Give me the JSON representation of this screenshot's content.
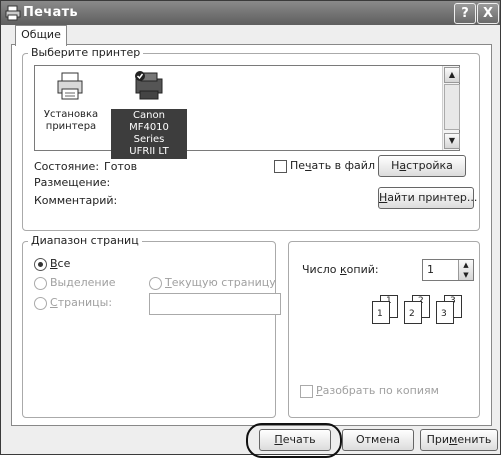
{
  "window": {
    "title": "Печать",
    "help_btn": "?",
    "close_btn": "X"
  },
  "tabs": [
    {
      "label": "Общие",
      "active": true
    }
  ],
  "printer_group": {
    "label": "Выберите принтер",
    "printers": [
      {
        "line1": "Установка",
        "line2": "принтера",
        "line3": "",
        "icon": "printer-add-icon",
        "selected": false
      },
      {
        "line1": "Canon",
        "line2": "MF4010 Series",
        "line3": "UFRII LT",
        "icon": "printer-default-icon",
        "selected": true
      }
    ]
  },
  "status": {
    "state_label": "Состояние:",
    "state_value": "Готов",
    "location_label": "Размещение:",
    "location_value": "",
    "comment_label": "Комментарий:",
    "comment_value": ""
  },
  "print_to_file": {
    "label_pre": "Пе",
    "label_u": "ч",
    "label_post": "ать в файл",
    "checked": false
  },
  "buttons": {
    "settings": {
      "pre": "Н",
      "u": "а",
      "post": "стройка"
    },
    "find_printer": {
      "pre": "",
      "u": "Н",
      "post": "айти принтер..."
    },
    "print": {
      "pre": "",
      "u": "П",
      "post": "ечать"
    },
    "cancel": "Отмена",
    "apply": {
      "pre": "При",
      "u": "м",
      "post": "енить"
    }
  },
  "page_range": {
    "label": "Диапазон страниц",
    "all": {
      "pre": "",
      "u": "В",
      "post": "се",
      "selected": true
    },
    "selection": {
      "pre": "Вы",
      "u": "д",
      "post": "еление",
      "enabled": false
    },
    "current_page": {
      "pre": "",
      "u": "Т",
      "post": "екущую страницу",
      "enabled": false
    },
    "pages": {
      "pre": "",
      "u": "С",
      "post": "траницы:",
      "enabled": false,
      "value": ""
    }
  },
  "copies": {
    "label_pre": "Число ",
    "label_u": "к",
    "label_post": "опий:",
    "value": "1",
    "collate": {
      "pre": "",
      "u": "Р",
      "post": "азобрать по копиям",
      "checked": false,
      "enabled": false
    },
    "pages_preview": [
      "1",
      "1",
      "2",
      "2",
      "3",
      "3"
    ]
  },
  "colors": {
    "titlebar": "#6b6b6b",
    "selected": "#3d3d3d"
  }
}
